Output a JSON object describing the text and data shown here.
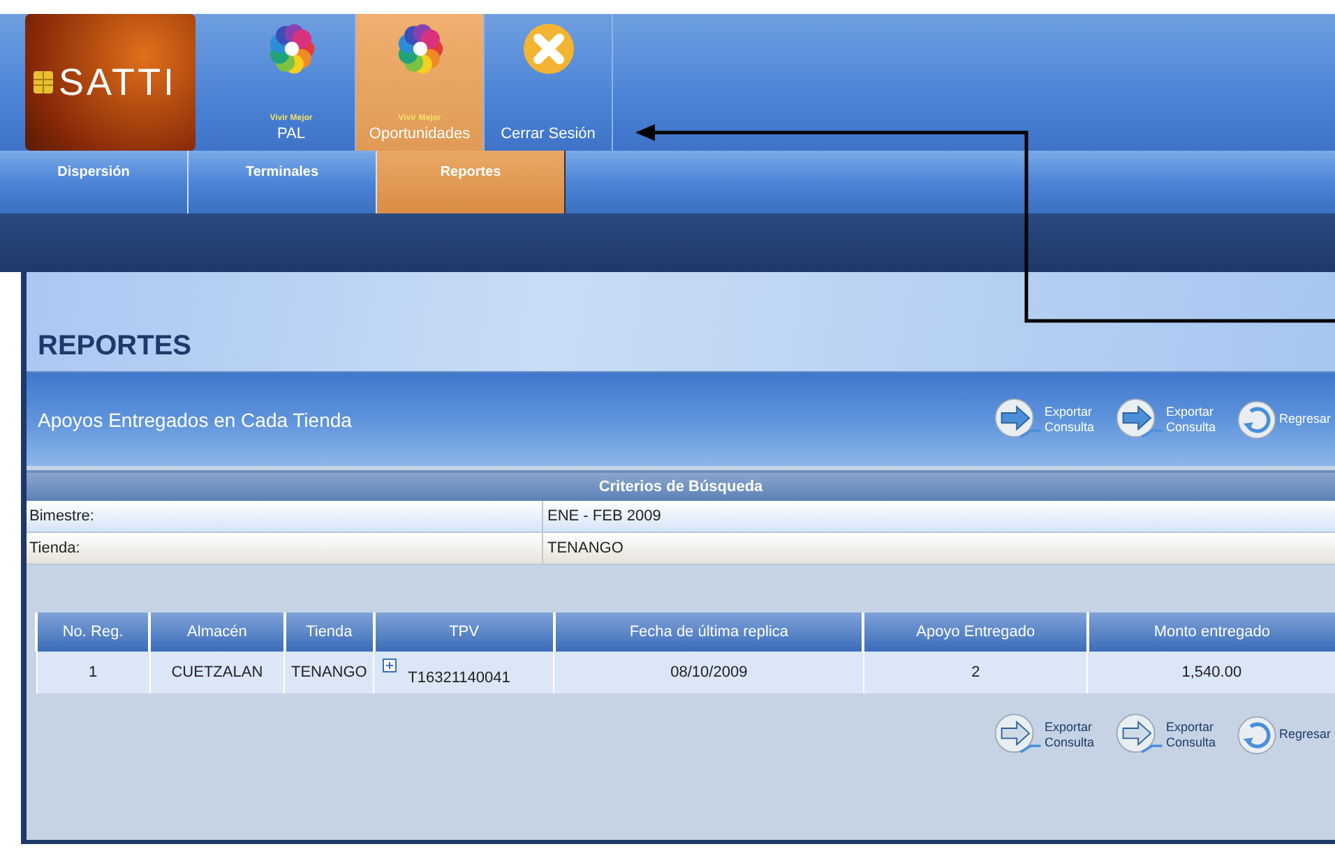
{
  "logo": {
    "text": "SATTI"
  },
  "nav": [
    {
      "kind": "flower",
      "caption": "Vivir Mejor",
      "label": "PAL",
      "selected": false
    },
    {
      "kind": "flower",
      "caption": "Vivir Mejor",
      "label": "Oportunidades",
      "selected": true
    },
    {
      "kind": "close",
      "label": "Cerrar Sesión",
      "selected": false
    }
  ],
  "subnav": [
    {
      "label": "Dispersión",
      "selected": false
    },
    {
      "label": "Terminales",
      "selected": false
    },
    {
      "label": "Reportes",
      "selected": true
    }
  ],
  "page_title": "REPORTES",
  "section_title": "Apoyos Entregados en Cada Tienda",
  "top_actions": [
    {
      "kind": "export",
      "label": "Exportar Consulta"
    },
    {
      "kind": "export",
      "label": "Exportar Consulta"
    },
    {
      "kind": "back",
      "label": "Regresar"
    }
  ],
  "criteria": {
    "title": "Criterios de Búsqueda",
    "rows": [
      {
        "label": "Bimestre:",
        "value": "ENE - FEB 2009"
      },
      {
        "label": "Tienda:",
        "value": "TENANGO"
      }
    ]
  },
  "table": {
    "columns": [
      "No. Reg.",
      "Almacén",
      "Tienda",
      "TPV",
      "Fecha de última replica",
      "Apoyo Entregado",
      "Monto entregado"
    ],
    "rows": [
      [
        "1",
        "CUETZALAN",
        "TENANGO",
        "T16321140041",
        "08/10/2009",
        "2",
        "1,540.00"
      ]
    ]
  },
  "bottom_actions": [
    {
      "kind": "export",
      "label": "Exportar Consulta"
    },
    {
      "kind": "export",
      "label": "Exportar Consulta"
    },
    {
      "kind": "back",
      "label": "Regresar"
    }
  ]
}
